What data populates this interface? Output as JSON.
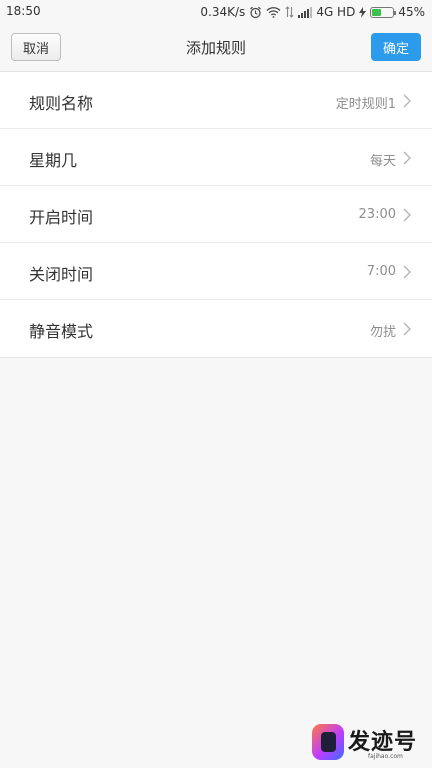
{
  "status_bar": {
    "time": "18:50",
    "speed": "0.34K/s",
    "network": "4G HD",
    "battery_level": 0.45,
    "battery_text": "45%"
  },
  "nav": {
    "cancel_label": "取消",
    "title": "添加规则",
    "confirm_label": "确定",
    "confirm_color": "#2d9bec"
  },
  "rows": [
    {
      "label": "规则名称",
      "value": "定时规则1"
    },
    {
      "label": "星期几",
      "value": "每天"
    },
    {
      "label": "开启时间",
      "value": "23:00"
    },
    {
      "label": "关闭时间",
      "value": "7:00"
    },
    {
      "label": "静音模式",
      "value": "勿扰"
    }
  ],
  "watermark": {
    "text": "发迹号",
    "sub": "fajihao.com"
  }
}
